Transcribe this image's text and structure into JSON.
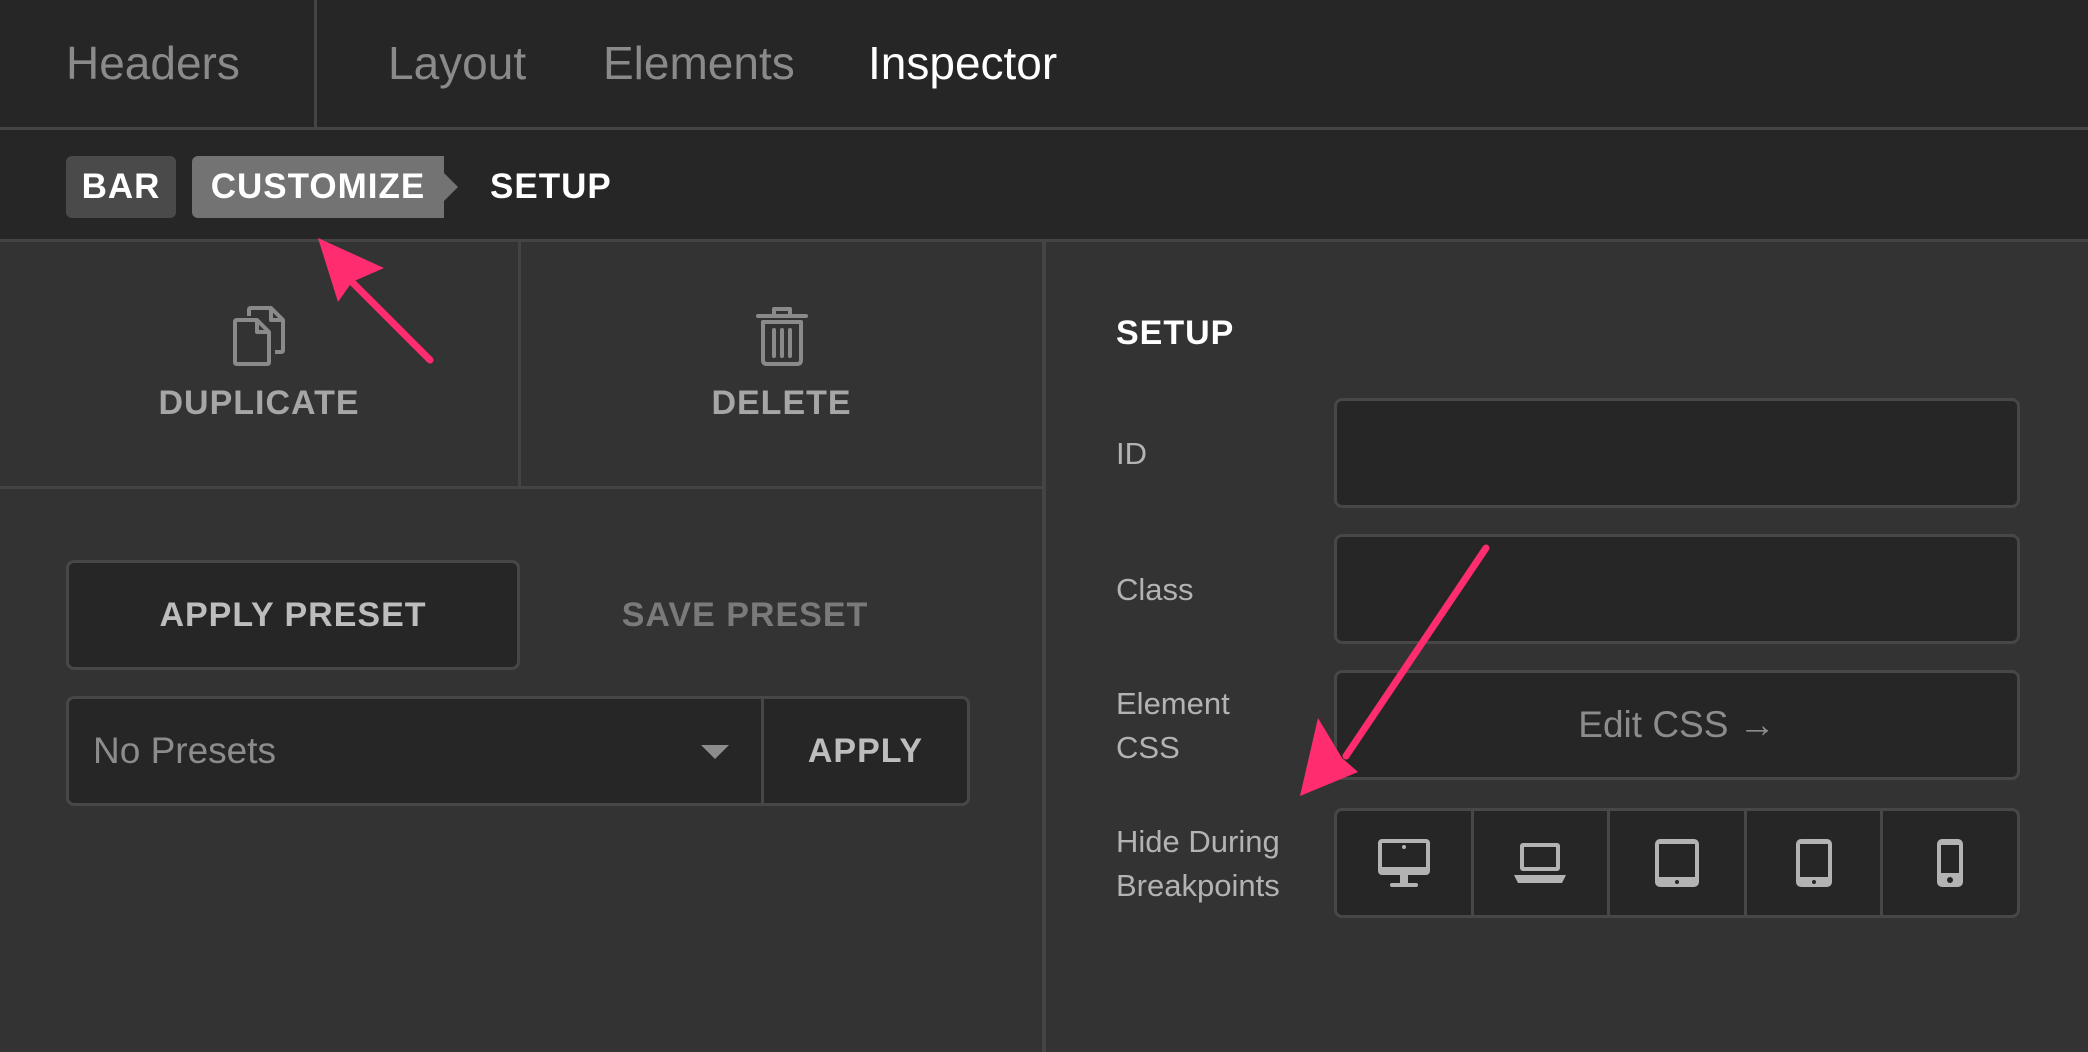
{
  "top_tabs": {
    "headers": "Headers",
    "layout": "Layout",
    "elements": "Elements",
    "inspector": "Inspector",
    "active": "Inspector"
  },
  "breadcrumb": {
    "bar": "BAR",
    "customize": "CUSTOMIZE",
    "setup": "SETUP"
  },
  "actions": {
    "duplicate": {
      "label": "DUPLICATE",
      "icon": "duplicate-icon"
    },
    "delete": {
      "label": "DELETE",
      "icon": "trash-icon"
    }
  },
  "presets": {
    "apply_preset": "APPLY PRESET",
    "save_preset": "SAVE PRESET",
    "select_value": "No Presets",
    "apply": "APPLY"
  },
  "setup": {
    "title": "SETUP",
    "id_label": "ID",
    "id_value": "",
    "class_label": "Class",
    "class_value": "",
    "element_css_label_1": "Element",
    "element_css_label_2": "CSS",
    "edit_css": "Edit CSS →",
    "hide_label_1": "Hide During",
    "hide_label_2": "Breakpoints",
    "breakpoints": [
      {
        "icon": "desktop-icon"
      },
      {
        "icon": "laptop-icon"
      },
      {
        "icon": "tablet-landscape-icon"
      },
      {
        "icon": "tablet-portrait-icon"
      },
      {
        "icon": "phone-icon"
      }
    ]
  },
  "colors": {
    "background": "#333333",
    "bar_background": "#262626",
    "accent_arrow": "#ff2d6f",
    "active_text": "#ffffff",
    "muted_text": "#8a8a8a"
  }
}
